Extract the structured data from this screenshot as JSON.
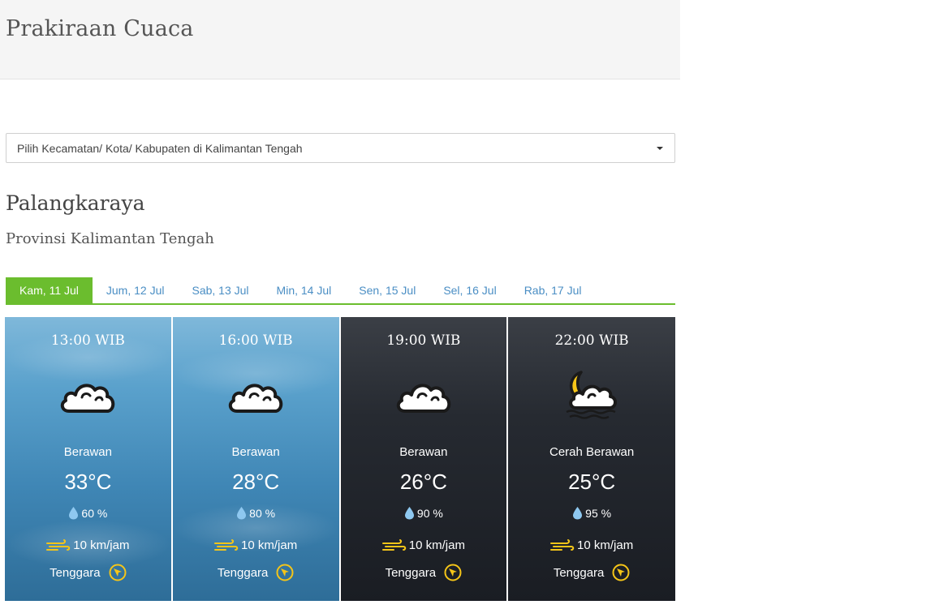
{
  "header": {
    "title": "Prakiraan Cuaca"
  },
  "location_select": {
    "placeholder": "Pilih Kecamatan/ Kota/ Kabupaten di Kalimantan Tengah"
  },
  "location": {
    "city": "Palangkaraya",
    "province": "Provinsi Kalimantan Tengah"
  },
  "tabs": [
    {
      "label": "Kam, 11 Jul",
      "active": true
    },
    {
      "label": "Jum, 12 Jul",
      "active": false
    },
    {
      "label": "Sab, 13 Jul",
      "active": false
    },
    {
      "label": "Min, 14 Jul",
      "active": false
    },
    {
      "label": "Sen, 15 Jul",
      "active": false
    },
    {
      "label": "Sel, 16 Jul",
      "active": false
    },
    {
      "label": "Rab, 17 Jul",
      "active": false
    }
  ],
  "forecasts": [
    {
      "time": "13:00 WIB",
      "condition": "Berawan",
      "temperature": "33°C",
      "humidity": "60 %",
      "wind_speed": "10 km/jam",
      "wind_direction": "Tenggara",
      "icon": "cloud-icon",
      "theme": "day"
    },
    {
      "time": "16:00 WIB",
      "condition": "Berawan",
      "temperature": "28°C",
      "humidity": "80 %",
      "wind_speed": "10 km/jam",
      "wind_direction": "Tenggara",
      "icon": "cloud-icon",
      "theme": "day"
    },
    {
      "time": "19:00 WIB",
      "condition": "Berawan",
      "temperature": "26°C",
      "humidity": "90 %",
      "wind_speed": "10 km/jam",
      "wind_direction": "Tenggara",
      "icon": "cloud-icon",
      "theme": "night"
    },
    {
      "time": "22:00 WIB",
      "condition": "Cerah Berawan",
      "temperature": "25°C",
      "humidity": "95 %",
      "wind_speed": "10 km/jam",
      "wind_direction": "Tenggara",
      "icon": "moon-cloud-icon",
      "theme": "night"
    }
  ],
  "colors": {
    "accent": "#6bbd2e",
    "link": "#4a8ec4",
    "icon_yellow": "#f5c518",
    "drop_blue": "#8ec8f0"
  }
}
